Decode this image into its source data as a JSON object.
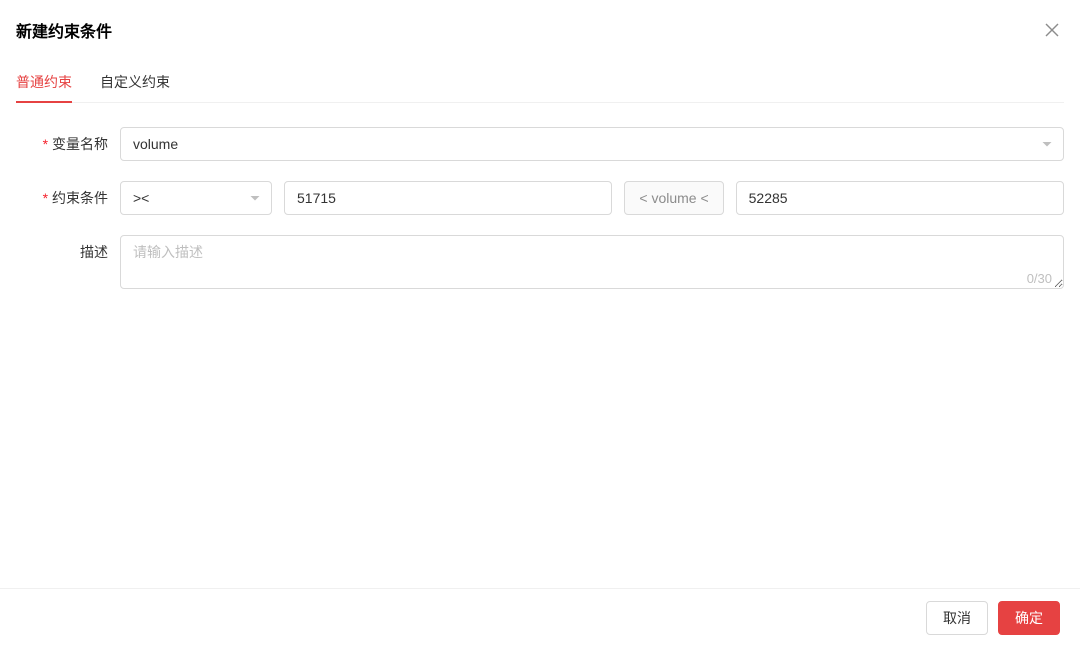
{
  "modal": {
    "title": "新建约束条件"
  },
  "tabs": {
    "standard": "普通约束",
    "custom": "自定义约束"
  },
  "form": {
    "variable": {
      "label": "变量名称",
      "value": "volume"
    },
    "constraint": {
      "label": "约束条件",
      "operator": "><",
      "lower": "51715",
      "between_label": "< volume <",
      "upper": "52285"
    },
    "description": {
      "label": "描述",
      "placeholder": "请输入描述",
      "value": "",
      "count": "0/30"
    }
  },
  "footer": {
    "cancel": "取消",
    "confirm": "确定"
  }
}
